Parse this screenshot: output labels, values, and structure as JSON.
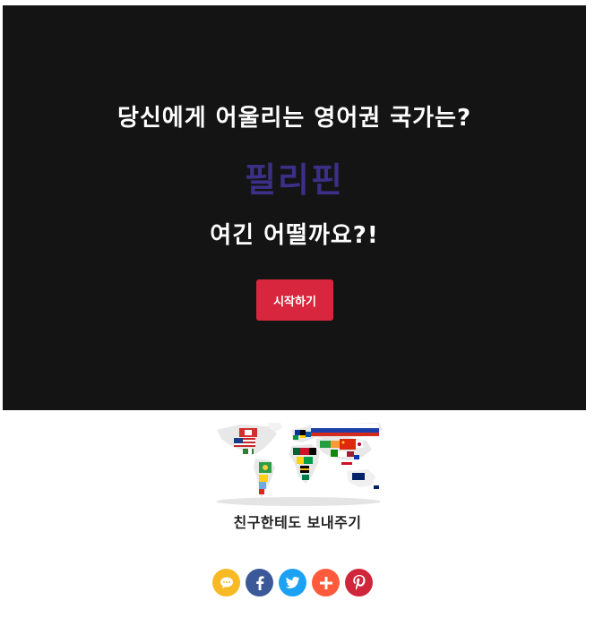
{
  "hero": {
    "question": "당신에게 어울리는 영어권 국가는?",
    "answer": "필리핀",
    "prompt": "여긴 어떨까요?!",
    "start_label": "시작하기",
    "answer_color": "#3b2f86",
    "button_color": "#d7263d"
  },
  "share": {
    "label": "친구한테도 보내주기",
    "buttons": [
      {
        "name": "kakao-talk",
        "icon": "speech-bubble-icon",
        "color": "#f7b924"
      },
      {
        "name": "facebook",
        "icon": "facebook-icon",
        "color": "#3b5998"
      },
      {
        "name": "twitter",
        "icon": "twitter-icon",
        "color": "#1da1f2"
      },
      {
        "name": "more",
        "icon": "plus-icon",
        "color": "#ff5a3c"
      },
      {
        "name": "pinterest",
        "icon": "pinterest-icon",
        "color": "#d0253a"
      }
    ]
  }
}
